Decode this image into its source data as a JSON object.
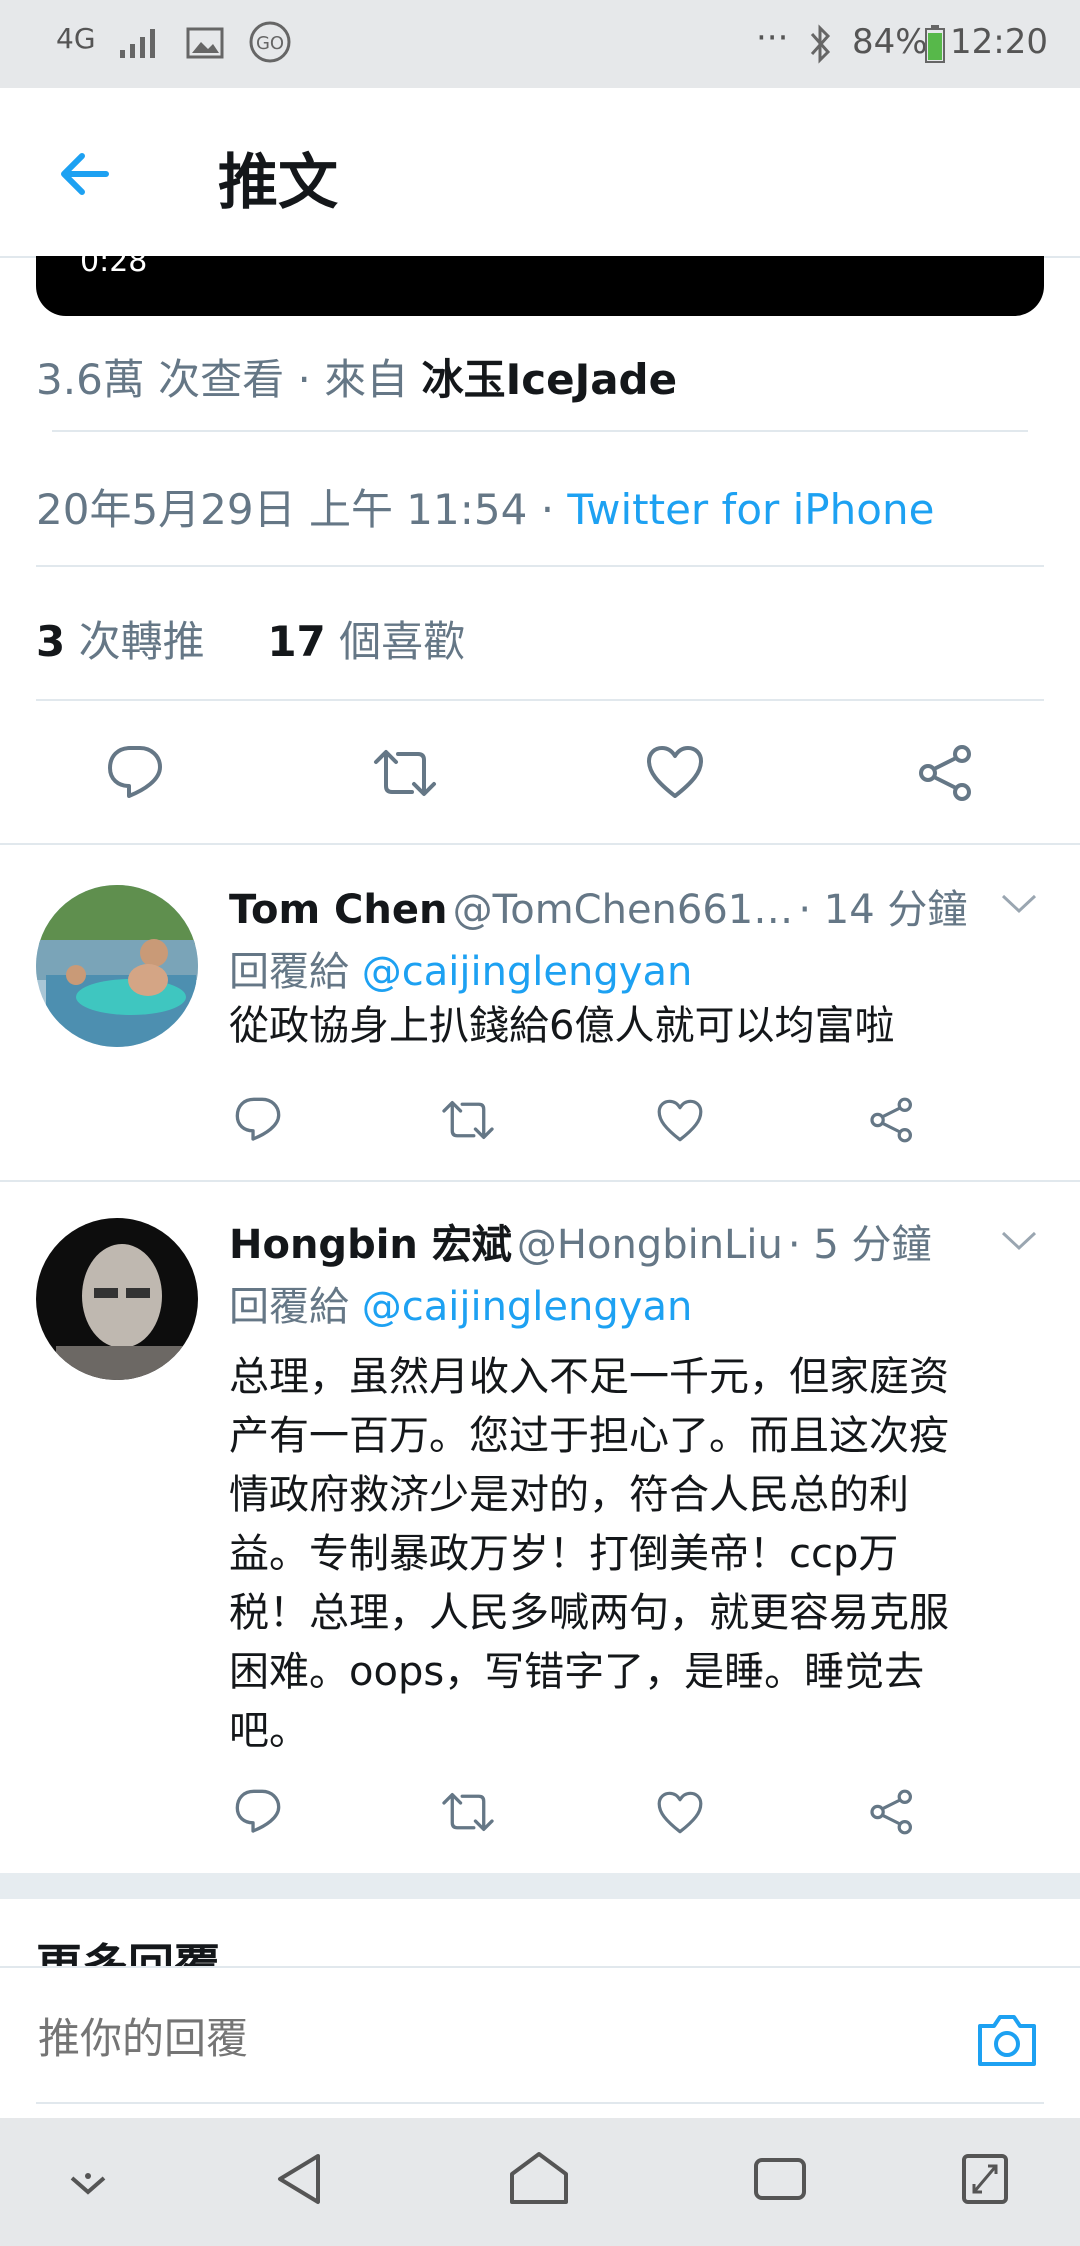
{
  "status_bar": {
    "network": "4G",
    "battery": "84%",
    "time": "12:20",
    "dots": "···"
  },
  "header": {
    "title": "推文"
  },
  "video": {
    "duration": "0:28"
  },
  "views": {
    "count": "3.6萬 次查看 · 來自",
    "source": "冰玉IceJade"
  },
  "tweet_meta": {
    "date": "20年5月29日 上午 11:54 ·",
    "client": "Twitter for iPhone"
  },
  "stats": {
    "retweets_count": "3",
    "retweets_label": "次轉推",
    "likes_count": "17",
    "likes_label": "個喜歡"
  },
  "replies": [
    {
      "name": "Tom Chen",
      "handle": "@TomChen661…",
      "time": "· 14 分鐘",
      "reply_to_label": "回覆給",
      "reply_to": "@caijinglengyan",
      "text": "從政協身上扒錢給6億人就可以均富啦"
    },
    {
      "name": "Hongbin 宏斌",
      "handle": "@HongbinLiu",
      "time": "· 5 分鐘",
      "reply_to_label": "回覆給",
      "reply_to": "@caijinglengyan",
      "text_lines": [
        "总理，虽然月收入不足一千元，但家庭资",
        "产有一百万。您过于担心了。而且这次疫",
        "情政府救济少是对的，符合人民总的利",
        "益。专制暴政万岁！打倒美帝！ccp万",
        "税！总理，人民多喊两句，就更容易克服",
        "困难。oops，写错字了，是睡。睡觉去",
        "吧。"
      ]
    }
  ],
  "more_replies": {
    "heading": "更多回覆"
  },
  "compose": {
    "placeholder": "推你的回覆"
  },
  "colors": {
    "accent": "#1da1f2",
    "muted": "#657786",
    "text": "#14171a"
  }
}
